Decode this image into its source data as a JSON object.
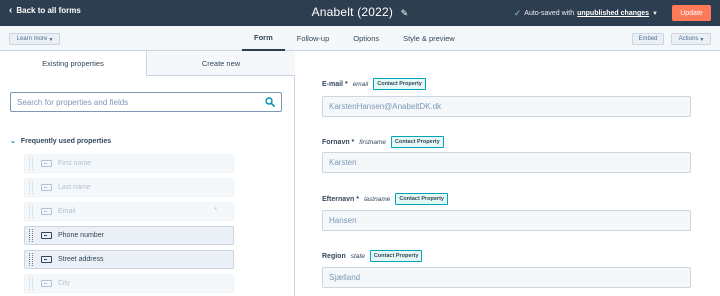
{
  "topbar": {
    "back_label": "Back to all forms",
    "title": "Anabelt  (2022)",
    "autosave_prefix": "Auto-saved with",
    "autosave_link": "unpublished changes",
    "update_label": "Update"
  },
  "navbar": {
    "learn_more_label": "Learn more",
    "tabs": [
      "Form",
      "Follow-up",
      "Options",
      "Style & preview"
    ],
    "active_tab": "Form",
    "embed_label": "Embed",
    "actions_label": "Actions"
  },
  "left": {
    "tab_existing": "Existing properties",
    "tab_create": "Create new",
    "search_placeholder": "Search for properties and fields",
    "section_title": "Frequently used properties",
    "properties": [
      {
        "label": "First name",
        "state": "muted"
      },
      {
        "label": "Last name",
        "state": "muted"
      },
      {
        "label": "Email",
        "state": "muted",
        "required_mark": "*"
      },
      {
        "label": "Phone number",
        "state": "active"
      },
      {
        "label": "Street address",
        "state": "active"
      },
      {
        "label": "City",
        "state": "muted"
      }
    ]
  },
  "form": {
    "badge_label": "Contact Property",
    "fields": [
      {
        "label": "E-mail *",
        "internal": "email",
        "value": "KarstenHansen@AnabeltDK.dk"
      },
      {
        "label": "Fornavn *",
        "internal": "firstname",
        "value": "Karsten"
      },
      {
        "label": "Efternavn *",
        "internal": "lastname",
        "value": "Hansen"
      },
      {
        "label": "Region",
        "internal": "state",
        "value": "Sjælland"
      }
    ]
  },
  "colors": {
    "topbar_bg": "#2d3e50",
    "accent_orange": "#ff7a59",
    "badge_border": "#00a4bd"
  }
}
